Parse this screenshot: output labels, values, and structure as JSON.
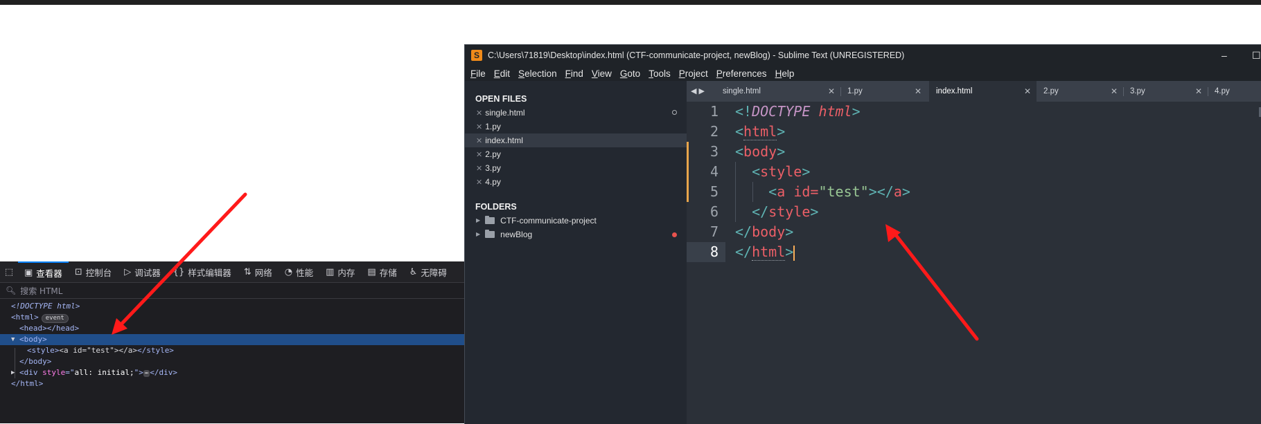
{
  "devtools": {
    "tabs": [
      {
        "label": "查看器",
        "icon": "inspector-icon"
      },
      {
        "label": "控制台",
        "icon": "console-icon"
      },
      {
        "label": "调试器",
        "icon": "debugger-icon"
      },
      {
        "label": "样式编辑器",
        "icon": "style-editor-icon"
      },
      {
        "label": "网络",
        "icon": "network-icon"
      },
      {
        "label": "性能",
        "icon": "performance-icon"
      },
      {
        "label": "内存",
        "icon": "memory-icon"
      },
      {
        "label": "存储",
        "icon": "storage-icon"
      },
      {
        "label": "无障碍",
        "icon": "accessibility-icon"
      }
    ],
    "search_placeholder": "搜索 HTML",
    "tree": {
      "doctype": "<!DOCTYPE html>",
      "html_open": "<html>",
      "event_badge": "event",
      "head": "<head></head>",
      "body_open": "<body>",
      "style_open": "<style>",
      "style_text": "<a id=\"test\"></a>",
      "style_close": "</style>",
      "body_close": "</body>",
      "div_open_tag": "<div",
      "div_attr": "style",
      "div_eq": "=\"",
      "div_val": "all: initial;",
      "div_end": "\">",
      "ellipsis": "⋯",
      "div_close": "</div>",
      "html_close": "</html>"
    }
  },
  "sublime": {
    "title": "C:\\Users\\71819\\Desktop\\index.html (CTF-communicate-project, newBlog) - Sublime Text (UNREGISTERED)",
    "logo": "S",
    "menu": [
      "File",
      "Edit",
      "Selection",
      "Find",
      "View",
      "Goto",
      "Tools",
      "Project",
      "Preferences",
      "Help"
    ],
    "sidebar": {
      "open_files_heading": "OPEN FILES",
      "open_files": [
        "single.html",
        "1.py",
        "index.html",
        "2.py",
        "3.py",
        "4.py"
      ],
      "folders_heading": "FOLDERS",
      "folders": [
        "CTF-communicate-project",
        "newBlog"
      ]
    },
    "tabs": [
      "single.html",
      "1.py",
      "index.html",
      "2.py",
      "3.py",
      "4.py"
    ],
    "active_tab": "index.html",
    "line_numbers": [
      "1",
      "2",
      "3",
      "4",
      "5",
      "6",
      "7",
      "8"
    ],
    "code": {
      "l1": {
        "open": "<!",
        "doctype": "DOCTYPE",
        "html": "html",
        "close": ">"
      },
      "l2": {
        "open": "<",
        "tag": "html",
        "close": ">"
      },
      "l3": {
        "open": "<",
        "tag": "body",
        "close": ">"
      },
      "l4": {
        "open": "<",
        "tag": "style",
        "close": ">"
      },
      "l5": {
        "open": "<",
        "tag": "a",
        "attr": "id",
        "eq": "=",
        "value": "\"test\"",
        "close": ">",
        "close_open": "</",
        "close_tag": "a",
        "close_end": ">"
      },
      "l6": {
        "open": "</",
        "tag": "style",
        "close": ">"
      },
      "l7": {
        "open": "</",
        "tag": "body",
        "close": ">"
      },
      "l8": {
        "open": "</",
        "tag": "html",
        "close": ">"
      }
    }
  },
  "colors": {
    "arrow": "#ff1a1a",
    "accent_devtools": "#0a84ff",
    "sublime_accent": "#ef8a1a"
  }
}
